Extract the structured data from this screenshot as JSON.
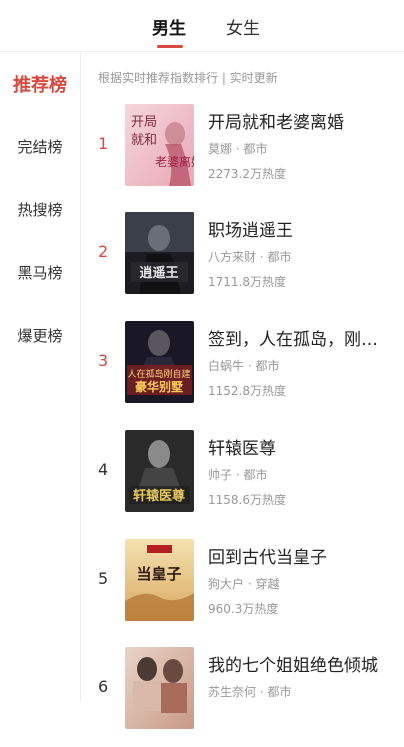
{
  "tabs": [
    {
      "label": "男生",
      "active": true
    },
    {
      "label": "女生",
      "active": false
    }
  ],
  "sidebar": [
    {
      "label": "推荐榜",
      "active": true
    },
    {
      "label": "完结榜",
      "active": false
    },
    {
      "label": "热搜榜",
      "active": false
    },
    {
      "label": "黑马榜",
      "active": false
    },
    {
      "label": "爆更榜",
      "active": false
    }
  ],
  "subtitle": "根据实时推荐指数排行 | 实时更新",
  "books": [
    {
      "rank": "1",
      "title": "开局就和老婆离婚",
      "author": "莫娜",
      "category": "都市",
      "meta": "莫娜 · 都市",
      "heat": "2273.2万热度",
      "cover_text": "开局就和老婆离婚"
    },
    {
      "rank": "2",
      "title": "职场逍遥王",
      "author": "八方来财",
      "category": "都市",
      "meta": "八方来财 · 都市",
      "heat": "1711.8万热度",
      "cover_text": "职场逍遥王"
    },
    {
      "rank": "3",
      "title": "签到，人在孤岛，刚…",
      "author": "白蜗牛",
      "category": "都市",
      "meta": "白蜗牛 · 都市",
      "heat": "1152.8万热度",
      "cover_text": "人在孤岛刚自建豪华别墅"
    },
    {
      "rank": "4",
      "title": "轩辕医尊",
      "author": "帅子",
      "category": "都市",
      "meta": "帅子 · 都市",
      "heat": "1158.6万热度",
      "cover_text": "轩辕医尊"
    },
    {
      "rank": "5",
      "title": "回到古代当皇子",
      "author": "狗大户",
      "category": "穿越",
      "meta": "狗大户 · 穿越",
      "heat": "960.3万热度",
      "cover_text": "当皇子"
    },
    {
      "rank": "6",
      "title": "我的七个姐姐绝色倾城",
      "author": "苏生奈何",
      "category": "都市",
      "meta": "苏生奈何 · 都市",
      "heat": "",
      "cover_text": ""
    }
  ]
}
